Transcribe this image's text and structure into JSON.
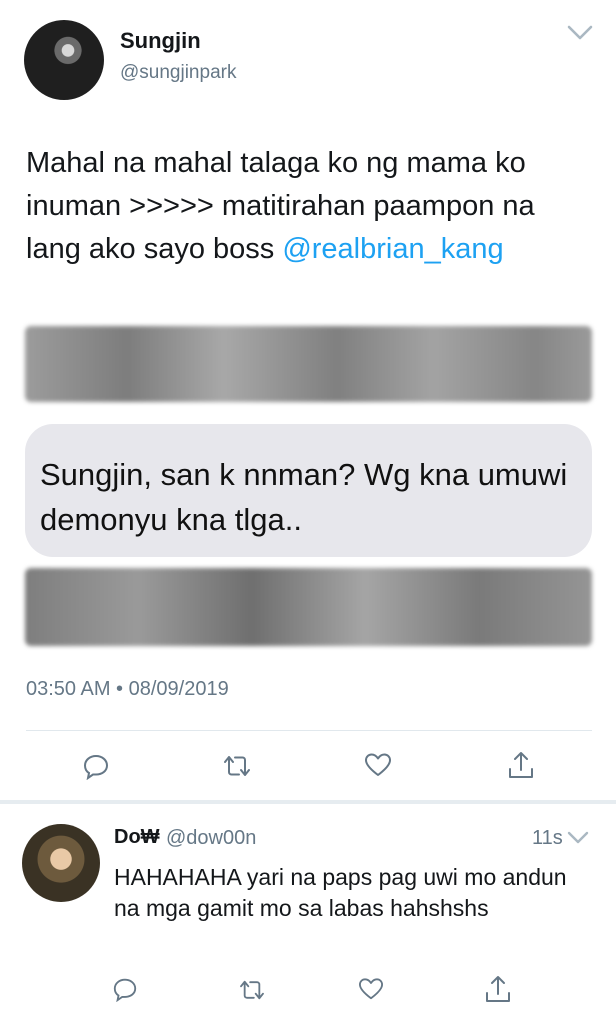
{
  "tweet": {
    "author_name": "Sungjin",
    "author_handle": "@sungjinpark",
    "text": "Mahal na mahal talaga ko ng mama ko inuman >>>>> matitirahan paampon na lang ako sayo boss ",
    "mention": "@realbrian_kang",
    "timestamp": "03:50 AM • 08/09/2019",
    "embedded_message": "Sungjin, san k nnman? Wg kna umuwi demonyu kna tlga.."
  },
  "reply": {
    "author_name": "Do₩",
    "author_handle": "@dow00n",
    "time": "11s",
    "text": "HAHAHAHA yari na paps pag uwi mo andun na mga gamit mo sa labas hahshshs"
  },
  "icons": {
    "reply": "reply-icon",
    "retweet": "retweet-icon",
    "like": "heart-icon",
    "share": "share-icon",
    "more": "chevron-down-icon"
  },
  "colors": {
    "link": "#1da1f2",
    "secondary_text": "#657786",
    "icon": "#657786",
    "bubble": "#e7e7ec"
  }
}
